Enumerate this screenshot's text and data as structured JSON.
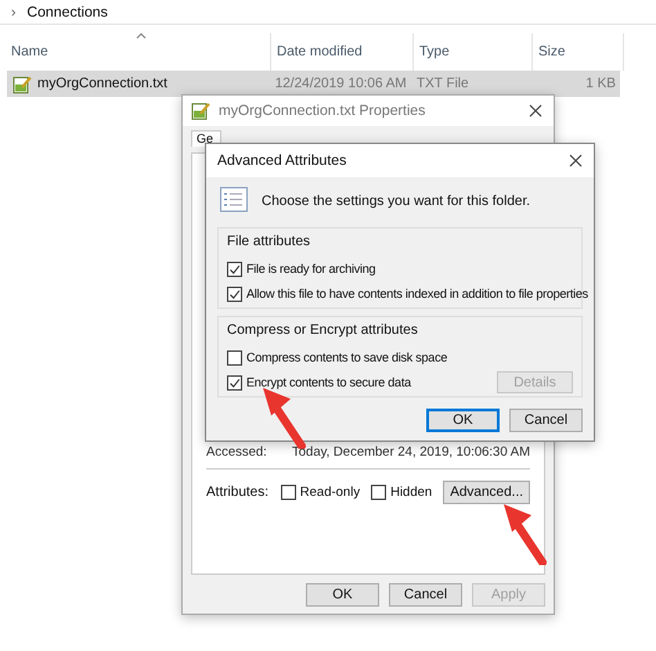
{
  "breadcrumb": {
    "separator": "›",
    "folder": "Connections"
  },
  "file_list": {
    "columns": [
      {
        "label": "Name",
        "sorted": true
      },
      {
        "label": "Date modified",
        "sorted": false
      },
      {
        "label": "Type",
        "sorted": false
      },
      {
        "label": "Size",
        "sorted": false
      }
    ],
    "rows": [
      {
        "name": "myOrgConnection.txt",
        "date_modified": "12/24/2019 10:06 AM",
        "type": "TXT File",
        "size": "1 KB",
        "selected": true
      }
    ]
  },
  "properties_window": {
    "title": "myOrgConnection.txt Properties",
    "tabs": [
      {
        "label": "Ge",
        "selected": true
      }
    ],
    "accessed_label": "Accessed:",
    "accessed_value": "Today, December 24, 2019, 10:06:30 AM",
    "attributes_label": "Attributes:",
    "attributes": [
      {
        "label": "Read-only",
        "checked": false
      },
      {
        "label": "Hidden",
        "checked": false
      }
    ],
    "advanced_button": "Advanced...",
    "buttons": [
      {
        "label": "OK",
        "disabled": false
      },
      {
        "label": "Cancel",
        "disabled": false
      },
      {
        "label": "Apply",
        "disabled": true
      }
    ]
  },
  "advanced_dialog": {
    "title": "Advanced Attributes",
    "prompt": "Choose the settings you want for this folder.",
    "groups": [
      {
        "title": "File attributes",
        "options": [
          {
            "label": "File is ready for archiving",
            "checked": true
          },
          {
            "label": "Allow this file to have contents indexed in addition to file properties",
            "checked": true
          }
        ]
      },
      {
        "title": "Compress or Encrypt attributes",
        "options": [
          {
            "label": "Compress contents to save disk space",
            "checked": false
          },
          {
            "label": "Encrypt contents to secure data",
            "checked": true
          }
        ],
        "button": {
          "label": "Details",
          "disabled": true
        }
      }
    ],
    "buttons": [
      {
        "label": "OK",
        "default": true
      },
      {
        "label": "Cancel",
        "default": false
      }
    ]
  }
}
